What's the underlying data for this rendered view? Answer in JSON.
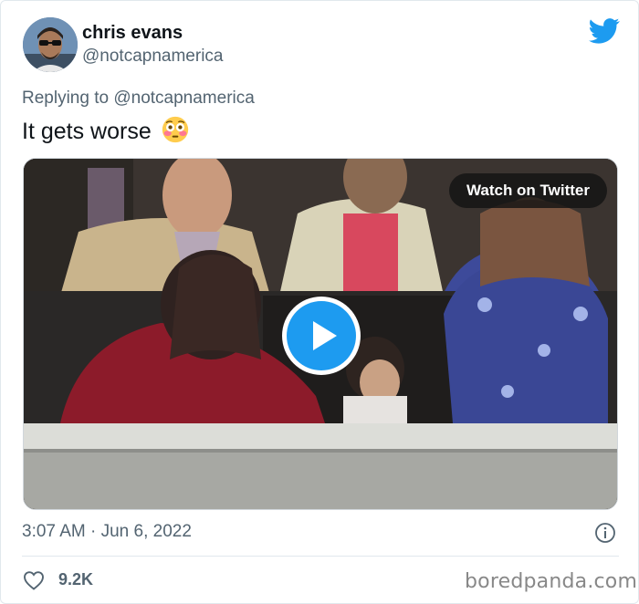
{
  "author": {
    "name": "chris evans",
    "handle": "@notcapnamerica"
  },
  "reply": {
    "prefix": "Replying to",
    "target": "@notcapnamerica"
  },
  "tweet": {
    "text": "It gets worse",
    "emoji": "flushed-face-emoji"
  },
  "media": {
    "watch_label": "Watch on Twitter",
    "play_icon": "play-icon"
  },
  "meta": {
    "timestamp": "3:07 AM · Jun 6, 2022",
    "likes": "9.2K"
  },
  "watermark": "boredpanda.com",
  "colors": {
    "brand": "#1d9bf0",
    "secondary_text": "#536471",
    "primary_text": "#0f1419"
  }
}
